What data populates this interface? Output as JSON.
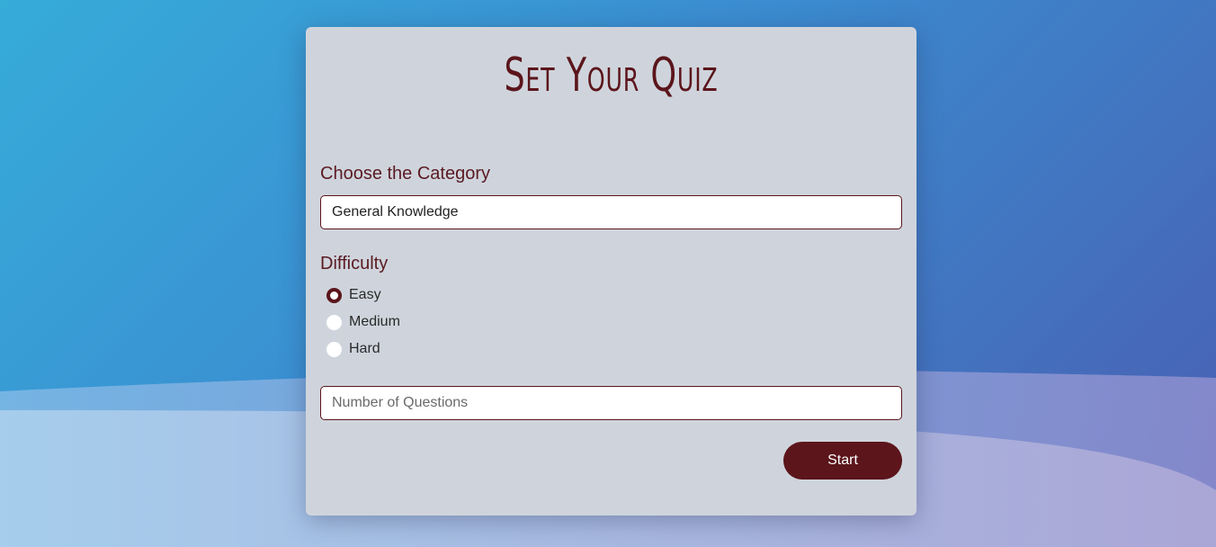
{
  "form": {
    "title": "Set Your Quiz",
    "category_label": "Choose the Category",
    "category_value": "General Knowledge",
    "difficulty_label": "Difficulty",
    "difficulty_options": [
      {
        "label": "Easy",
        "checked": true
      },
      {
        "label": "Medium",
        "checked": false
      },
      {
        "label": "Hard",
        "checked": false
      }
    ],
    "questions_placeholder": "Number of Questions",
    "questions_value": "",
    "start_label": "Start"
  },
  "colors": {
    "accent": "#5b151b",
    "card_background": "#cfd4dc",
    "background_start": "#36acd9",
    "background_end": "#4a5db0"
  }
}
